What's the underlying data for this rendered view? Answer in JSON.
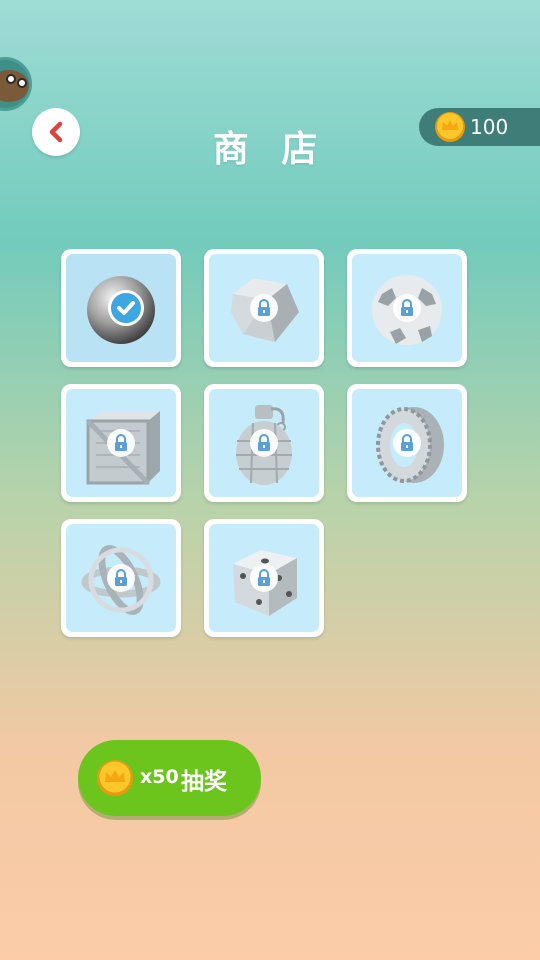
{
  "header": {
    "title": "商 店",
    "coins": "100"
  },
  "shop": {
    "items": [
      {
        "icon": "metal-ball-icon",
        "state": "selected"
      },
      {
        "icon": "rock-polyhedron-icon",
        "state": "locked"
      },
      {
        "icon": "soccer-ball-icon",
        "state": "locked"
      },
      {
        "icon": "wooden-crate-icon",
        "state": "locked"
      },
      {
        "icon": "grenade-icon",
        "state": "locked"
      },
      {
        "icon": "tire-wheel-icon",
        "state": "locked"
      },
      {
        "icon": "gyroscope-icon",
        "state": "locked"
      },
      {
        "icon": "dice-icon",
        "state": "locked"
      }
    ]
  },
  "lottery": {
    "cost": "x50",
    "label": "抽奖"
  },
  "colors": {
    "lock": "#5a9fd6",
    "accent_green": "#6cc51c",
    "coin_gold": "#f5b817",
    "back_arrow": "#e0413a"
  }
}
